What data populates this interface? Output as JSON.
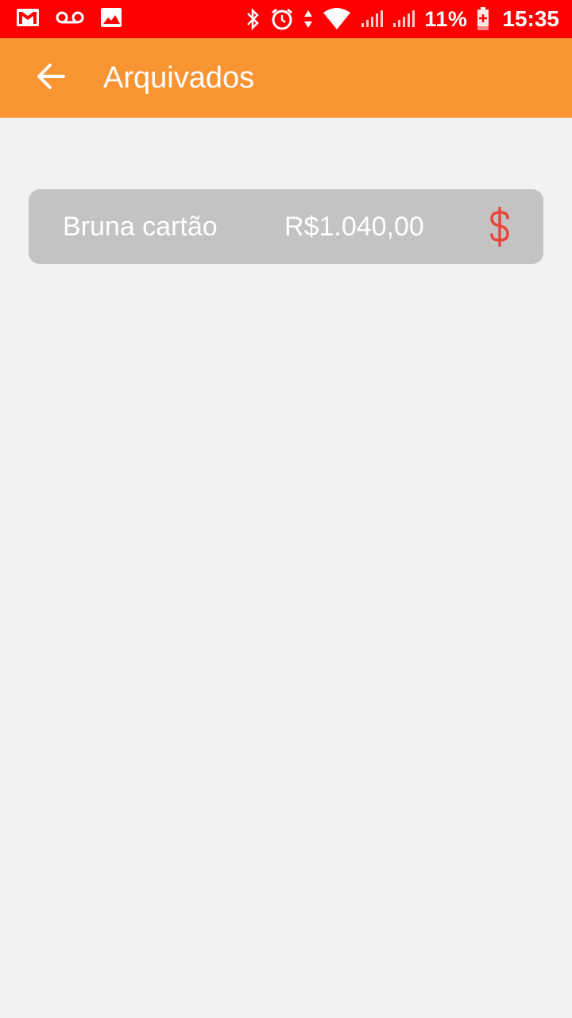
{
  "status_bar": {
    "icons_left": [
      "gmail-icon",
      "voicemail-icon",
      "image-icon"
    ],
    "icons_right": [
      "bluetooth-icon",
      "alarm-icon",
      "data-arrows-icon",
      "wifi-icon",
      "signal-icon",
      "signal-icon",
      "battery-charging-icon"
    ],
    "battery": "11%",
    "time": "15:35",
    "background": "#ff0000"
  },
  "app_bar": {
    "title": "Arquivados",
    "back_icon": "arrow-left-icon",
    "background": "#f99432"
  },
  "items": [
    {
      "name": "Bruna cartão",
      "value": "R$1.040,00",
      "icon": "dollar-icon",
      "icon_color": "#e8473a"
    }
  ]
}
